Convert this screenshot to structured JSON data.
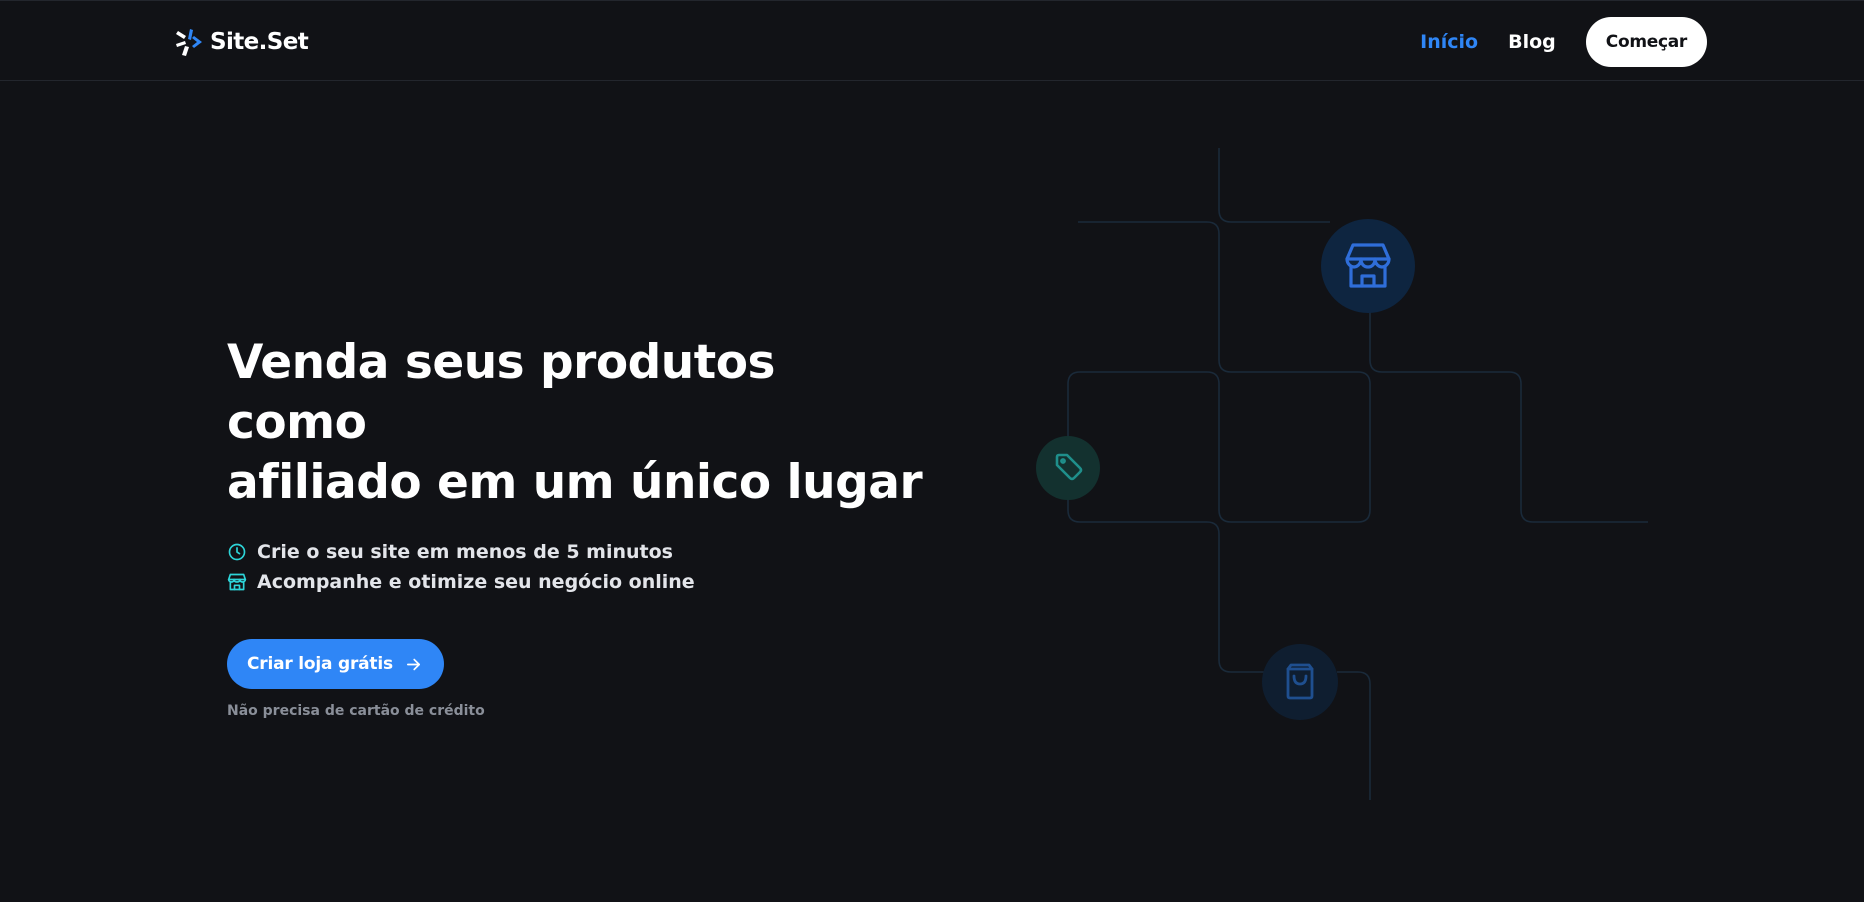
{
  "brand": {
    "name": "Site.Set",
    "colors": {
      "accent": "#2f86f6",
      "teal": "#2dd4d8",
      "background": "#111216"
    }
  },
  "nav": {
    "items": [
      {
        "label": "Início",
        "active": true
      },
      {
        "label": "Blog",
        "active": false
      }
    ],
    "cta_label": "Começar"
  },
  "hero": {
    "title_line1": "Venda seus produtos como",
    "title_line2": "afiliado em um único lugar",
    "bullets": [
      {
        "icon": "clock-icon",
        "text": "Crie o seu site em menos de 5 minutos"
      },
      {
        "icon": "store-icon",
        "text": "Acompanhe e otimize seu negócio online"
      }
    ],
    "cta_label": "Criar loja grátis",
    "cta_icon": "arrow-right-icon",
    "note": "Não precisa de cartão de crédito"
  },
  "illustration": {
    "icons": [
      "store-icon",
      "tag-icon",
      "shopping-bag-icon"
    ]
  }
}
